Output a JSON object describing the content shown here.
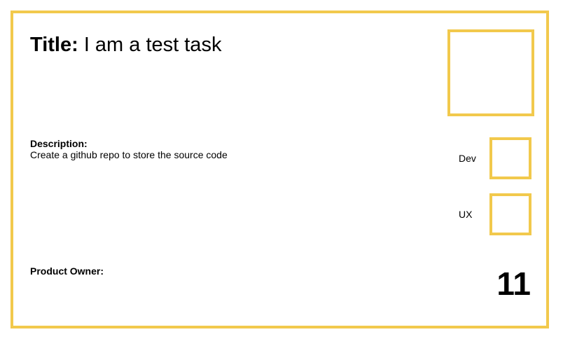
{
  "card": {
    "title_label": "Title:",
    "title_value": "I am a test task",
    "description_label": "Description:",
    "description_value": "Create a github repo to store the source code",
    "roles": [
      {
        "label": "Dev"
      },
      {
        "label": "UX"
      }
    ],
    "product_owner_label": "Product Owner:",
    "task_number": "11"
  },
  "colors": {
    "border": "#f2c94c",
    "text": "#000000",
    "background": "#ffffff"
  }
}
